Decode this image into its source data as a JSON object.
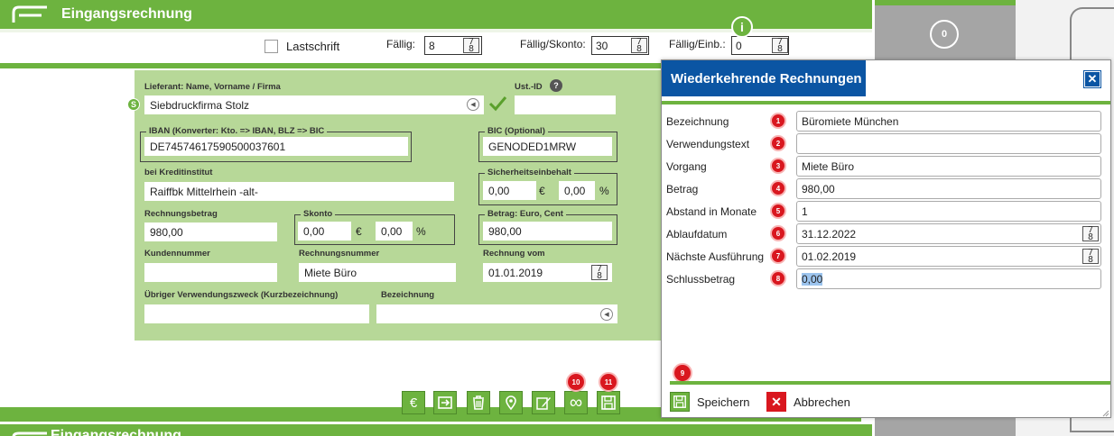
{
  "window": {
    "title": "Eingangsrechnung",
    "next_title": "Eingangsrechnung"
  },
  "options": {
    "lastschrift_label": "Lastschrift",
    "faellig_label": "Fällig:",
    "faellig_value": "8",
    "faellig_skonto_label": "Fällig/Skonto:",
    "faellig_skonto_value": "30",
    "faellig_einb_label": "Fällig/Einb.:",
    "faellig_einb_value": "0",
    "info_icon_glyph": "i",
    "calendar_glyph_top": "7",
    "calendar_glyph_bottom": "8"
  },
  "form": {
    "supplier_label": "Lieferant: Name, Vorname / Firma",
    "supplier_value": "Siebdruckfirma Stolz",
    "supplier_badge": "S",
    "ust_label": "Ust.-ID",
    "ust_value": "",
    "iban_label": "IBAN (Konverter: Kto. => IBAN, BLZ => BIC",
    "iban_value": "DE74574617590500037601",
    "bic_label": "BIC (Optional)",
    "bic_value": "GENODED1MRW",
    "bank_label": "bei Kreditinstitut",
    "bank_value": "Raiffbk Mittelrhein -alt-",
    "security_label": "Sicherheitseinbehalt",
    "security_amount": "0,00",
    "security_percent": "0,00",
    "invoice_amount_label": "Rechnungsbetrag",
    "invoice_amount_value": "980,00",
    "skonto_label": "Skonto",
    "skonto_amount": "0,00",
    "skonto_percent": "0,00",
    "euro_sign": "€",
    "percent_sign": "%",
    "amount_ec_label": "Betrag: Euro, Cent",
    "amount_ec_value": "980,00",
    "customer_no_label": "Kundennummer",
    "customer_no_value": "",
    "invoice_no_label": "Rechnungsnummer",
    "invoice_no_value": "Miete Büro",
    "invoice_date_label": "Rechnung vom",
    "invoice_date_value": "01.01.2019",
    "purpose_label": "Übriger Verwendungszweck (Kurzbezeichnung)",
    "purpose_value": "",
    "designation_label": "Bezeichnung",
    "designation_value": ""
  },
  "toolbar": {
    "badge_10": "10",
    "badge_11": "11",
    "euro_glyph": "€",
    "infinity_glyph": "∞"
  },
  "right": {
    "circle_value": "0"
  },
  "dialog": {
    "title": "Wiederkehrende Rechnungen",
    "close_glyph": "✕",
    "fields": [
      {
        "label": "Bezeichnung",
        "badge": "1",
        "value": "Büromiete München"
      },
      {
        "label": "Verwendungstext",
        "badge": "2",
        "value": ""
      },
      {
        "label": "Vorgang",
        "badge": "3",
        "value": "Miete Büro"
      },
      {
        "label": "Betrag",
        "badge": "4",
        "value": "980,00"
      },
      {
        "label": "Abstand in Monate",
        "badge": "5",
        "value": "1"
      },
      {
        "label": "Ablaufdatum",
        "badge": "6",
        "value": "31.12.2022"
      },
      {
        "label": "Nächste Ausführung",
        "badge": "7",
        "value": "01.02.2019"
      },
      {
        "label": "Schlussbetrag",
        "badge": "8",
        "value": "0,00"
      }
    ],
    "badge_9": "9",
    "save_label": "Speichern",
    "cancel_label": "Abbrechen",
    "cancel_glyph": "✕",
    "colors": {
      "accent": "#6db33f",
      "title_bg": "#0b55a3",
      "badge": "#d9171f",
      "cancel": "#d9171f"
    }
  }
}
